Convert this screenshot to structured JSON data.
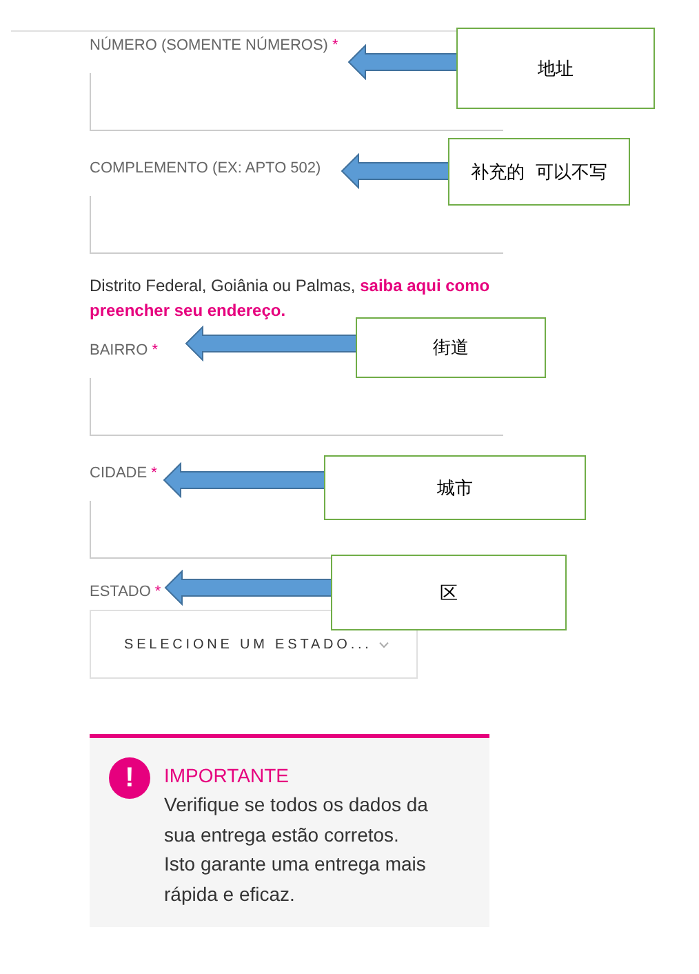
{
  "form": {
    "fields": [
      {
        "kind": "input",
        "label": "NÚMERO (SOMENTE NÚMEROS)",
        "required_mark": "*"
      },
      {
        "kind": "input",
        "label": "COMPLEMENTO (EX: APTO 502)"
      },
      {
        "kind": "note",
        "text": "Distrito Federal, Goiânia ou Palmas,",
        "link_lines": [
          "saiba aqui como",
          "preencher seu endereço."
        ]
      },
      {
        "kind": "input",
        "label": "BAIRRO",
        "required_mark": "*"
      },
      {
        "kind": "input",
        "label": "CIDADE",
        "required_mark": "*"
      },
      {
        "kind": "select",
        "label": "ESTADO",
        "required_mark": "*",
        "placeholder": "SELECIONE UM ESTADO..."
      }
    ]
  },
  "notice": {
    "icon": "!",
    "title": "IMPORTANTE",
    "lines": [
      "Verifique se todos os dados da",
      "sua entrega estão corretos.",
      "Isto garante uma entrega mais",
      "rápida e eficaz."
    ]
  },
  "annotations": [
    {
      "text": "地址"
    },
    {
      "text": "补充的  可以不写"
    },
    {
      "text": "街道"
    },
    {
      "text": "城市"
    },
    {
      "text": "区"
    }
  ]
}
